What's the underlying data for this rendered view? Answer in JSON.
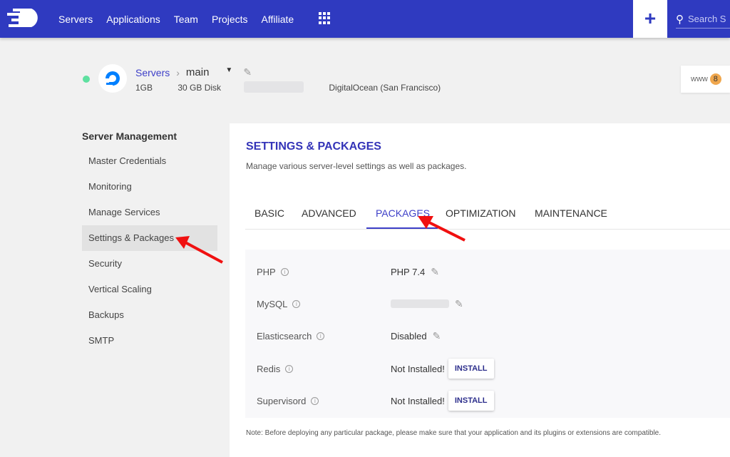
{
  "topbar": {
    "nav": [
      "Servers",
      "Applications",
      "Team",
      "Projects",
      "Affiliate"
    ],
    "search_placeholder": "Search S",
    "brand_color": "#2f3ac0"
  },
  "server": {
    "breadcrumb_root": "Servers",
    "name": "main",
    "ram": "1GB",
    "disk": "30 GB Disk",
    "provider": "DigitalOcean (San Francisco)",
    "status_color": "#5ee0a0"
  },
  "www": {
    "label": "www",
    "count": "8"
  },
  "sidebar": {
    "heading": "Server Management",
    "items": [
      "Master Credentials",
      "Monitoring",
      "Manage Services",
      "Settings & Packages",
      "Security",
      "Vertical Scaling",
      "Backups",
      "SMTP"
    ],
    "active": "Settings & Packages"
  },
  "main": {
    "title": "SETTINGS & PACKAGES",
    "subtitle": "Manage various server-level settings as well as packages.",
    "tabs": [
      "BASIC",
      "ADVANCED",
      "PACKAGES",
      "OPTIMIZATION",
      "MAINTENANCE"
    ],
    "active_tab": "PACKAGES",
    "packages": [
      {
        "name": "PHP",
        "value": "PHP 7.4"
      },
      {
        "name": "MySQL",
        "value": ""
      },
      {
        "name": "Elasticsearch",
        "value": "Disabled"
      },
      {
        "name": "Redis",
        "value": "Not Installed!",
        "action": "INSTALL"
      },
      {
        "name": "Supervisord",
        "value": "Not Installed!",
        "action": "INSTALL"
      }
    ],
    "note": "Note: Before deploying any particular package, please make sure that your application and its plugins or extensions are compatible."
  }
}
